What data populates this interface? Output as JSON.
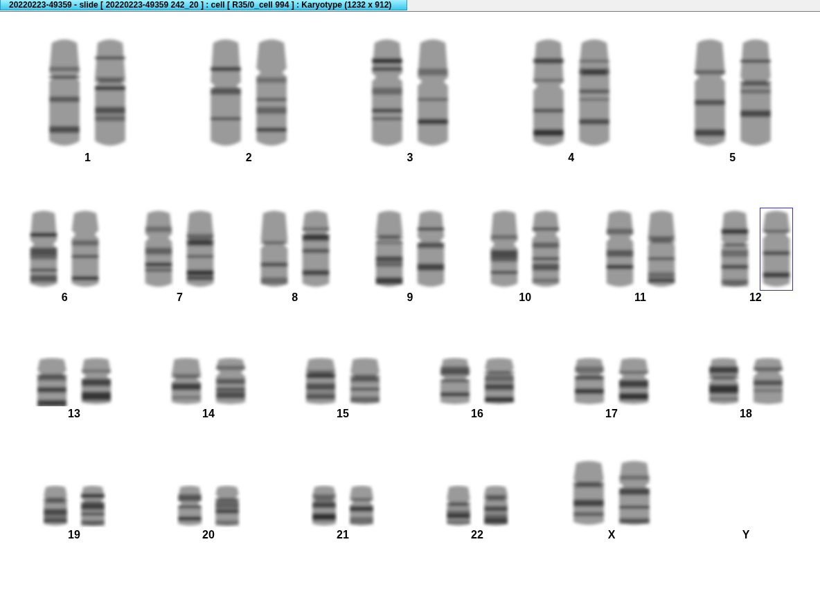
{
  "window": {
    "title": "20220223-49359 - slide [ 20220223-49359 242_20 ] : cell [ R35/0_cell 994 ] : Karyotype  (1232 x 912)"
  },
  "karyotype": {
    "rows": [
      {
        "pairs": [
          {
            "label": "1",
            "chromosomes": [
              {
                "selected": false
              },
              {
                "selected": false
              }
            ]
          },
          {
            "label": "2",
            "chromosomes": [
              {
                "selected": false
              },
              {
                "selected": false
              }
            ]
          },
          {
            "label": "3",
            "chromosomes": [
              {
                "selected": false
              },
              {
                "selected": false
              }
            ]
          },
          {
            "label": "4",
            "chromosomes": [
              {
                "selected": false
              },
              {
                "selected": false
              }
            ]
          },
          {
            "label": "5",
            "chromosomes": [
              {
                "selected": false
              },
              {
                "selected": false
              }
            ]
          }
        ]
      },
      {
        "pairs": [
          {
            "label": "6",
            "chromosomes": [
              {
                "selected": false
              },
              {
                "selected": false
              }
            ]
          },
          {
            "label": "7",
            "chromosomes": [
              {
                "selected": false
              },
              {
                "selected": false
              }
            ]
          },
          {
            "label": "8",
            "chromosomes": [
              {
                "selected": false
              },
              {
                "selected": false
              }
            ]
          },
          {
            "label": "9",
            "chromosomes": [
              {
                "selected": false
              },
              {
                "selected": false
              }
            ]
          },
          {
            "label": "10",
            "chromosomes": [
              {
                "selected": false
              },
              {
                "selected": false
              }
            ]
          },
          {
            "label": "11",
            "chromosomes": [
              {
                "selected": false
              },
              {
                "selected": false
              }
            ]
          },
          {
            "label": "12",
            "chromosomes": [
              {
                "selected": false
              },
              {
                "selected": true
              }
            ]
          }
        ]
      },
      {
        "pairs": [
          {
            "label": "13",
            "chromosomes": [
              {
                "selected": false
              },
              {
                "selected": false
              }
            ]
          },
          {
            "label": "14",
            "chromosomes": [
              {
                "selected": false
              },
              {
                "selected": false
              }
            ]
          },
          {
            "label": "15",
            "chromosomes": [
              {
                "selected": false
              },
              {
                "selected": false
              }
            ]
          },
          {
            "label": "16",
            "chromosomes": [
              {
                "selected": false
              },
              {
                "selected": false
              }
            ]
          },
          {
            "label": "17",
            "chromosomes": [
              {
                "selected": false
              },
              {
                "selected": false
              }
            ]
          },
          {
            "label": "18",
            "chromosomes": [
              {
                "selected": false
              },
              {
                "selected": false
              }
            ]
          }
        ]
      },
      {
        "pairs": [
          {
            "label": "19",
            "chromosomes": [
              {
                "selected": false
              },
              {
                "selected": false
              }
            ]
          },
          {
            "label": "20",
            "chromosomes": [
              {
                "selected": false
              },
              {
                "selected": false
              }
            ]
          },
          {
            "label": "21",
            "chromosomes": [
              {
                "selected": false
              },
              {
                "selected": false
              }
            ]
          },
          {
            "label": "22",
            "chromosomes": [
              {
                "selected": false
              },
              {
                "selected": false
              }
            ]
          },
          {
            "label": "X",
            "chromosomes": [
              {
                "selected": false
              },
              {
                "selected": false
              }
            ]
          },
          {
            "label": "Y"
          }
        ]
      }
    ]
  }
}
